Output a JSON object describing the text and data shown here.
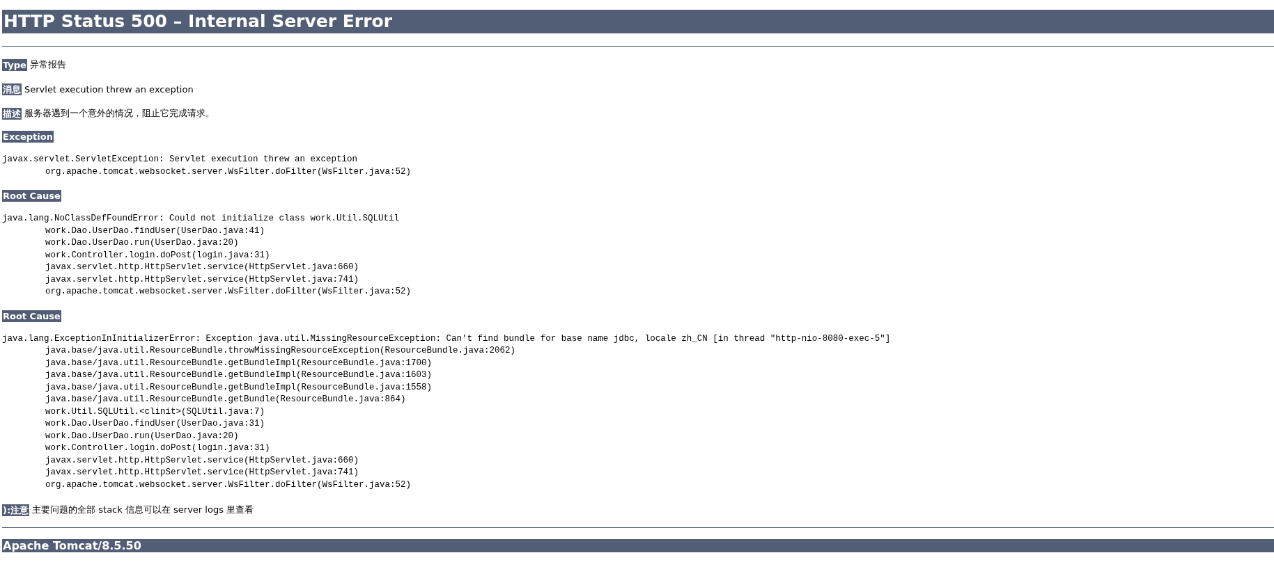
{
  "title": "HTTP Status 500 – Internal Server Error",
  "fields": [
    {
      "label": "Type",
      "value": "异常报告"
    },
    {
      "label": "消息",
      "value": "Servlet execution threw an exception"
    },
    {
      "label": "描述",
      "value": "服务器遇到一个意外的情况，阻止它完成请求。"
    }
  ],
  "sections": [
    {
      "heading": "Exception",
      "message": "javax.servlet.ServletException: Servlet execution threw an exception",
      "frames": [
        "org.apache.tomcat.websocket.server.WsFilter.doFilter(WsFilter.java:52)"
      ]
    },
    {
      "heading": "Root Cause",
      "message": "java.lang.NoClassDefFoundError: Could not initialize class work.Util.SQLUtil",
      "frames": [
        "work.Dao.UserDao.findUser(UserDao.java:41)",
        "work.Dao.UserDao.run(UserDao.java:20)",
        "work.Controller.login.doPost(login.java:31)",
        "javax.servlet.http.HttpServlet.service(HttpServlet.java:660)",
        "javax.servlet.http.HttpServlet.service(HttpServlet.java:741)",
        "org.apache.tomcat.websocket.server.WsFilter.doFilter(WsFilter.java:52)"
      ]
    },
    {
      "heading": "Root Cause",
      "message": "java.lang.ExceptionInInitializerError: Exception java.util.MissingResourceException: Can't find bundle for base name jdbc, locale zh_CN [in thread \"http-nio-8080-exec-5\"]",
      "frames": [
        "java.base/java.util.ResourceBundle.throwMissingResourceException(ResourceBundle.java:2062)",
        "java.base/java.util.ResourceBundle.getBundleImpl(ResourceBundle.java:1700)",
        "java.base/java.util.ResourceBundle.getBundleImpl(ResourceBundle.java:1603)",
        "java.base/java.util.ResourceBundle.getBundleImpl(ResourceBundle.java:1558)",
        "java.base/java.util.ResourceBundle.getBundle(ResourceBundle.java:864)",
        "work.Util.SQLUtil.<clinit>(SQLUtil.java:7)",
        "work.Dao.UserDao.findUser(UserDao.java:31)",
        "work.Dao.UserDao.run(UserDao.java:20)",
        "work.Controller.login.doPost(login.java:31)",
        "javax.servlet.http.HttpServlet.service(HttpServlet.java:660)",
        "javax.servlet.http.HttpServlet.service(HttpServlet.java:741)",
        "org.apache.tomcat.websocket.server.WsFilter.doFilter(WsFilter.java:52)"
      ]
    }
  ],
  "note": {
    "label": "):注意",
    "text": "主要问题的全部 stack 信息可以在 server logs 里查看"
  },
  "footer": "Apache Tomcat/8.5.50"
}
